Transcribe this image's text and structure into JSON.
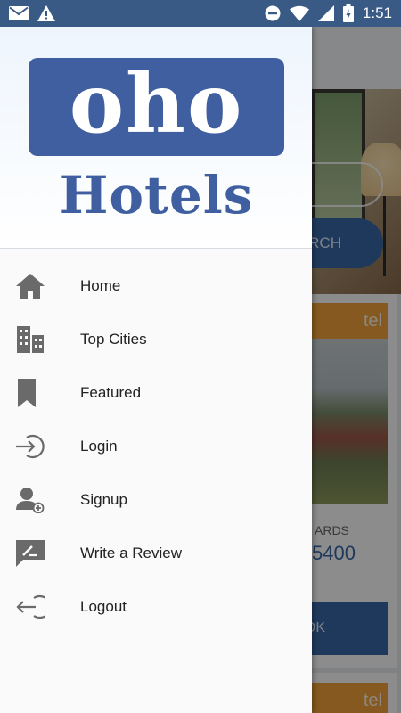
{
  "status_bar": {
    "time": "1:51",
    "left_icons": [
      "mail-icon",
      "warning-icon"
    ],
    "right_icons": [
      "do-not-disturb-icon",
      "wifi-icon",
      "signal-icon",
      "battery-charging-icon"
    ]
  },
  "drawer": {
    "logo": {
      "top_text": "oho",
      "bottom_text": "Hotels"
    },
    "menu": [
      {
        "label": "Home",
        "icon": "home-icon"
      },
      {
        "label": "Top Cities",
        "icon": "city-icon"
      },
      {
        "label": "Featured",
        "icon": "bookmark-icon"
      },
      {
        "label": "Login",
        "icon": "login-icon"
      },
      {
        "label": "Signup",
        "icon": "signup-icon"
      },
      {
        "label": "Write a Review",
        "icon": "review-icon"
      },
      {
        "label": "Logout",
        "icon": "logout-icon"
      }
    ]
  },
  "background": {
    "search_button_fragment": "RCH",
    "hotel_tag_fragment": "tel",
    "rewards_fragment": "ARDS",
    "price_fragment": "5400",
    "book_button_fragment": "OK",
    "hotel_tag2_fragment": "tel"
  },
  "colors": {
    "status_bar": "#3a5a86",
    "brand_blue": "#3f5fa0",
    "accent_orange": "#f2a33a",
    "icon_gray": "#666666"
  }
}
